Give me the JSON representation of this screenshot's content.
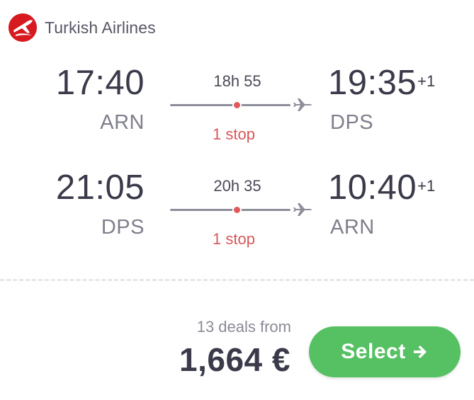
{
  "airline": {
    "name": "Turkish Airlines",
    "logo_icon": "turkish-airlines-logo-icon",
    "brand_color": "#d71920"
  },
  "outbound": {
    "departure_time": "17:40",
    "departure_airport": "ARN",
    "duration": "18h 55",
    "stops": "1 stop",
    "arrival_time": "19:35",
    "arrival_day_offset": "+1",
    "arrival_airport": "DPS",
    "plane_icon": "plane-icon"
  },
  "return": {
    "departure_time": "21:05",
    "departure_airport": "DPS",
    "duration": "20h 35",
    "stops": "1 stop",
    "arrival_time": "10:40",
    "arrival_day_offset": "+1",
    "arrival_airport": "ARN",
    "plane_icon": "plane-icon"
  },
  "pricing": {
    "deals_text": "13 deals from",
    "price": "1,664 €"
  },
  "select_button": {
    "label": "Select",
    "icon": "arrow-right-icon",
    "color": "#55c163"
  },
  "colors": {
    "stop_color": "#d8585a",
    "text_primary": "#3a3a4a",
    "text_secondary": "#7f7f8c"
  }
}
